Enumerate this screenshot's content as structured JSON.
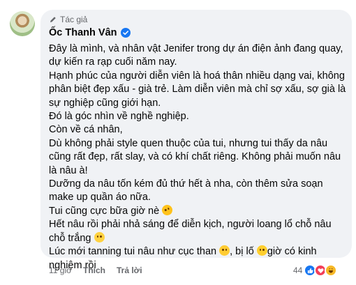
{
  "comment": {
    "author_badge": "Tác giả",
    "author_name": "Ốc Thanh Vân",
    "lines": [
      "Đây là mình, và nhân vật Jenifer trong dự án điện ảnh đang quay,",
      "dự kiến ra rạp cuối năm nay.",
      "Hạnh phúc của người diễn viên là hoá thân nhiều dạng vai, không",
      "phân biệt đẹp xấu - già trẻ. Làm diễn viên mà chỉ sợ xấu, sợ già là",
      "sự nghiệp cũng giới hạn.",
      "Đó là góc nhìn về nghề nghiệp.",
      "Còn về cá nhân,",
      "Dù không phải style quen thuộc của tui, nhưng tui thấy da nâu",
      "cũng rất đẹp, rất slay, và có khí chất riêng. Không phải muốn nâu",
      "là nâu à!",
      "Dưỡng da nâu tốn kém đủ thứ hết à nha, còn thêm sửa soạn",
      "make up quần áo nữa.",
      "Tui cũng cực bữa giờ nè",
      "Hết nâu rồi phải nhả sáng để diễn kịch, người loang lổ chỗ nâu",
      "chỗ trắng",
      "Lúc mới tanning tui nâu như cục than",
      ", bị lố",
      "giờ có kinh",
      "nghiệm rồi"
    ],
    "emoji": [
      "rofl-emoji",
      "sweat-smile-emoji",
      "cold-sweat-emoji",
      "tongue-emoji"
    ]
  },
  "footer": {
    "time": "11 giờ",
    "like_label": "Thích",
    "reply_label": "Trả lời"
  },
  "reactions": {
    "count": "44",
    "types": [
      "like",
      "love",
      "haha"
    ]
  },
  "colors": {
    "bubble": "#f0f2f5",
    "verified": "#1877f2",
    "meta_text": "#65676b"
  }
}
